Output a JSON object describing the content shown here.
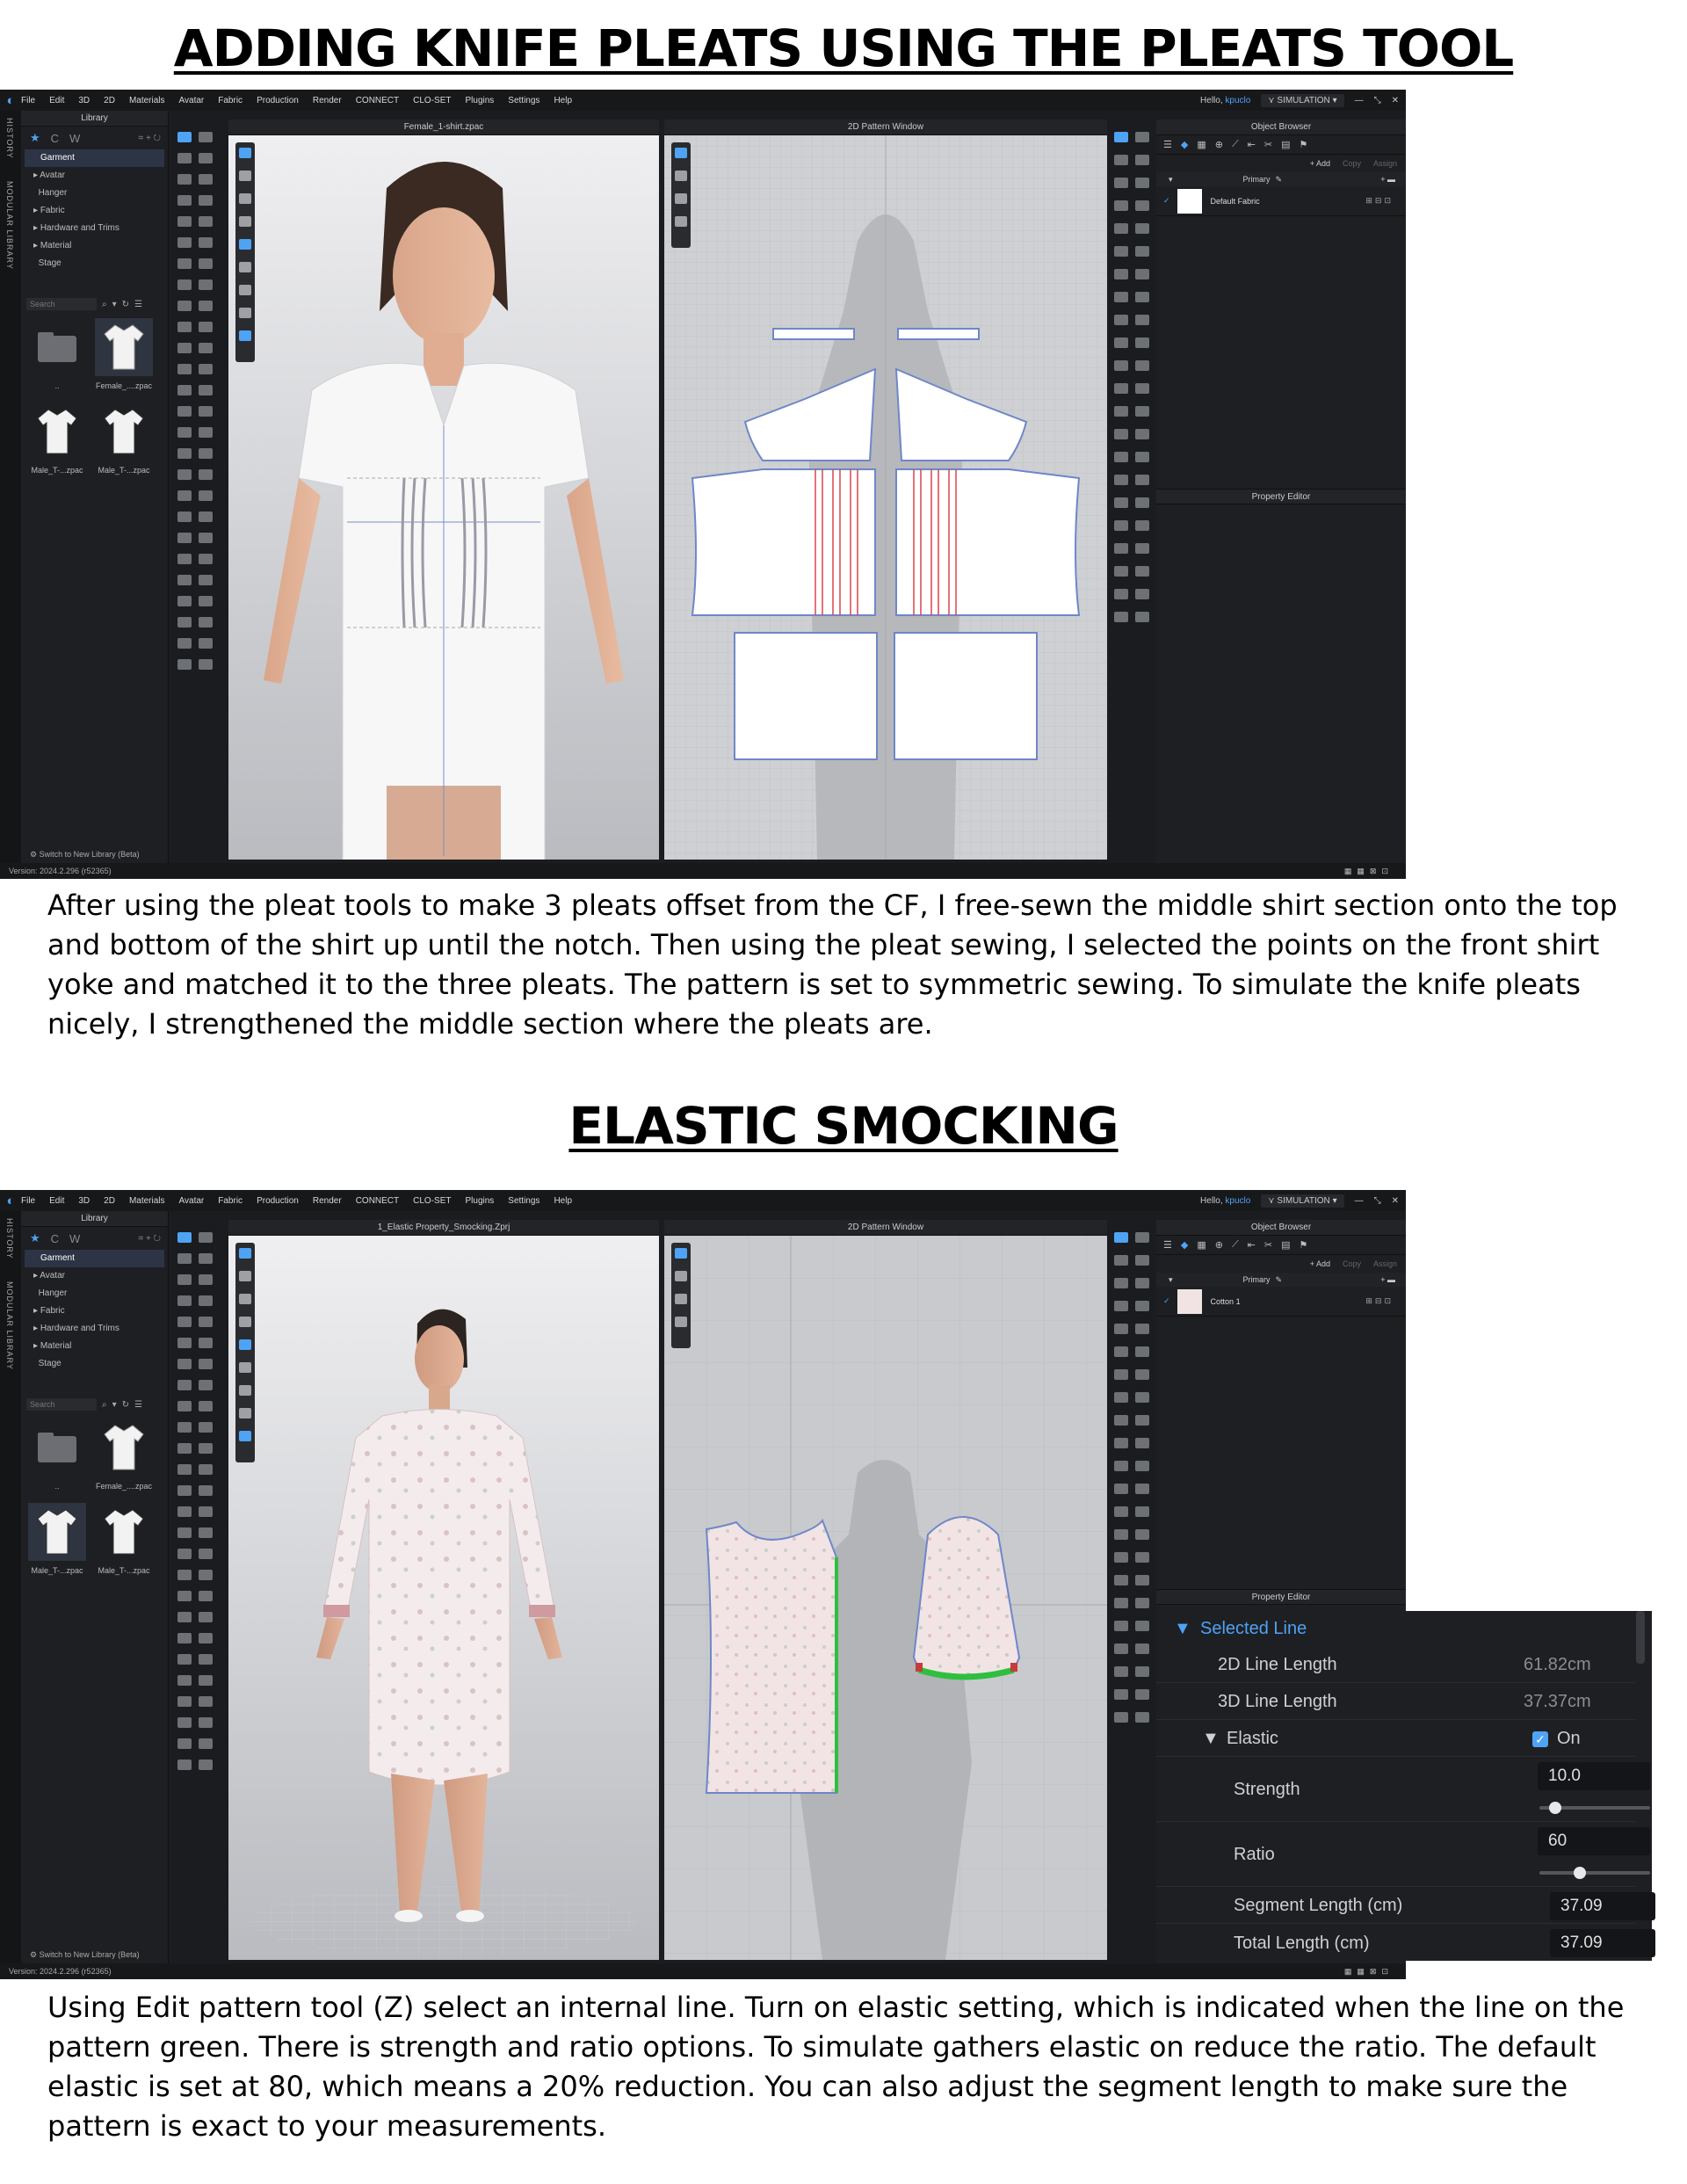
{
  "section1": {
    "title": "ADDING KNIFE PLEATS USING THE PLEATS TOOL",
    "description": "After using the pleat tools to make 3 pleats offset from the CF, I free-sewn the middle shirt section onto the top and bottom of the shirt up until the notch. Then using the pleat sewing, I selected the points on the front shirt yoke and matched it to the three pleats. The pattern is set to symmetric sewing. To simulate the knife pleats nicely, I strengthened the middle section where the pleats are.",
    "app": {
      "menu": [
        "File",
        "Edit",
        "3D",
        "2D",
        "Materials",
        "Avatar",
        "Fabric",
        "Production",
        "Render",
        "CONNECT",
        "CLO-SET",
        "Plugins",
        "Settings",
        "Help"
      ],
      "greeting": "Hello,",
      "user": "kpuclo",
      "mode": "SIMULATION",
      "side_tabs": [
        "HISTORY",
        "MODULAR LIBRARY"
      ],
      "library_title": "Library",
      "library_tree": [
        "Garment",
        "Avatar",
        "Hanger",
        "Fabric",
        "Hardware and Trims",
        "Material",
        "Stage"
      ],
      "search_placeholder": "Search",
      "thumbs": [
        "..",
        "Female_....zpac",
        "Male_T-...zpac",
        "Male_T-...zpac"
      ],
      "view3d_title": "Female_1-shirt.zpac",
      "view2d_title": "2D Pattern Window",
      "object_browser_title": "Object Browser",
      "add_label": "+ Add",
      "copy_label": "Copy",
      "assign_label": "Assign",
      "primary_label": "Primary",
      "fabric_name": "Default Fabric",
      "property_editor_title": "Property Editor",
      "switch_library": "Switch to New Library (Beta)",
      "version": "Version: 2024.2.296 (r52365)"
    }
  },
  "section2": {
    "title": "ELASTIC SMOCKING",
    "description": "Using Edit pattern tool (Z) select an internal line. Turn on elastic setting, which is indicated when the line on the pattern green. There is strength and ratio options. To simulate gathers elastic on reduce the ratio. The default elastic is set at 80, which means a 20% reduction. You can also adjust the segment length to make sure the pattern is exact to your measurements.",
    "app": {
      "menu": [
        "File",
        "Edit",
        "3D",
        "2D",
        "Materials",
        "Avatar",
        "Fabric",
        "Production",
        "Render",
        "CONNECT",
        "CLO-SET",
        "Plugins",
        "Settings",
        "Help"
      ],
      "greeting": "Hello,",
      "user": "kpuclo",
      "mode": "SIMULATION",
      "side_tabs": [
        "HISTORY",
        "MODULAR LIBRARY"
      ],
      "library_title": "Library",
      "library_tree": [
        "Garment",
        "Avatar",
        "Hanger",
        "Fabric",
        "Hardware and Trims",
        "Material",
        "Stage"
      ],
      "search_placeholder": "Search",
      "thumbs": [
        "..",
        "Female_....zpac",
        "Male_T-...zpac",
        "Male_T-...zpac"
      ],
      "view3d_title": "1_Elastic Property_Smocking.Zprj",
      "view2d_title": "2D Pattern Window",
      "object_browser_title": "Object Browser",
      "add_label": "+ Add",
      "copy_label": "Copy",
      "assign_label": "Assign",
      "primary_label": "Primary",
      "fabric_name": "Cotton 1",
      "property_editor_title": "Property Editor",
      "switch_library": "Switch to New Library (Beta)",
      "version": "Version: 2024.2.296 (r52365)"
    },
    "property_editor": {
      "selected_line": "Selected Line",
      "line_2d_label": "2D Line Length",
      "line_2d_value": "61.82cm",
      "line_3d_label": "3D Line Length",
      "line_3d_value": "37.37cm",
      "elastic_label": "Elastic",
      "elastic_on": "On",
      "strength_label": "Strength",
      "strength_value": "10.0",
      "strength_fraction": 0.1,
      "ratio_label": "Ratio",
      "ratio_value": "60",
      "ratio_fraction": 0.35,
      "segment_label": "Segment Length (cm)",
      "segment_value": "37.09",
      "total_label": "Total Length (cm)",
      "total_value": "37.09"
    }
  },
  "colors": {
    "app_bg": "#1b1c1f",
    "accent": "#4ea3f5",
    "elastic_line": "#2fbf3f"
  }
}
